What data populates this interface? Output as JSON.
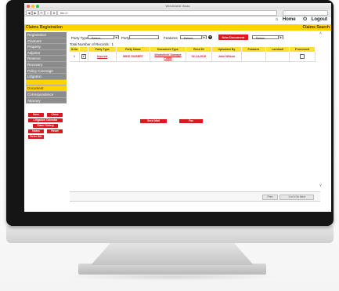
{
  "browser": {
    "window_title": "Windshield Glass",
    "address": "file:///",
    "nav_buttons": [
      "◀",
      "▶",
      "⟳",
      "⌂",
      "★"
    ]
  },
  "header": {
    "home_label": "Home",
    "logout_label": "Logout",
    "page_title": "Claims Registration",
    "right_label": "Claims Search"
  },
  "sidebar": {
    "items": [
      {
        "label": "Registration"
      },
      {
        "label": "Claimant"
      },
      {
        "label": "Property"
      },
      {
        "label": "Adjuster"
      },
      {
        "label": "Reserve"
      },
      {
        "label": "Recovery"
      },
      {
        "label": "Policy Coverage"
      },
      {
        "label": "Litigation"
      },
      {
        "label": ""
      },
      {
        "label": "Document"
      },
      {
        "label": "Correspondence"
      },
      {
        "label": "Attorney"
      }
    ],
    "buttons": {
      "save": "Save",
      "close": "Close",
      "litigation_calendar": "Litigation Calendar",
      "claim_history": "Claim History",
      "notes": "Notes",
      "reset": "Reset",
      "refer_siu": "Refer SIU"
    }
  },
  "filters": {
    "party_type_label": "Party Type",
    "party_type_value": "--Select--",
    "party_label": "Party",
    "party_value": "",
    "features_label": "Features",
    "features_value": "--Select--",
    "new_document_label": "New Document",
    "select_value": "--Select--"
  },
  "records": {
    "total_label": "Total Number of Records :",
    "total_value": "1"
  },
  "table": {
    "columns": [
      "S.No",
      "",
      "Party Type",
      "Party Name",
      "Document Type",
      "Recd Dt",
      "Uploaded By",
      "Features",
      "Landsall",
      "Processed"
    ],
    "rows": [
      {
        "sno": "1",
        "party_type": "Insured",
        "party_name": "MIKE GILBERT",
        "document_type": "Windshield Damage Photo",
        "recd_dt": "02-14-2018",
        "uploaded_by": "John Wilson",
        "features": "",
        "landsall": ""
      }
    ]
  },
  "actions": {
    "send_mail": "Send Mail",
    "fax": "Fax"
  },
  "pager": {
    "prev": "Prev",
    "next": "1 to 6 Go Next"
  },
  "colors": {
    "accent_yellow": "#ffd200",
    "button_red": "#d71920",
    "sidebar_gray": "#8c8c8c"
  }
}
